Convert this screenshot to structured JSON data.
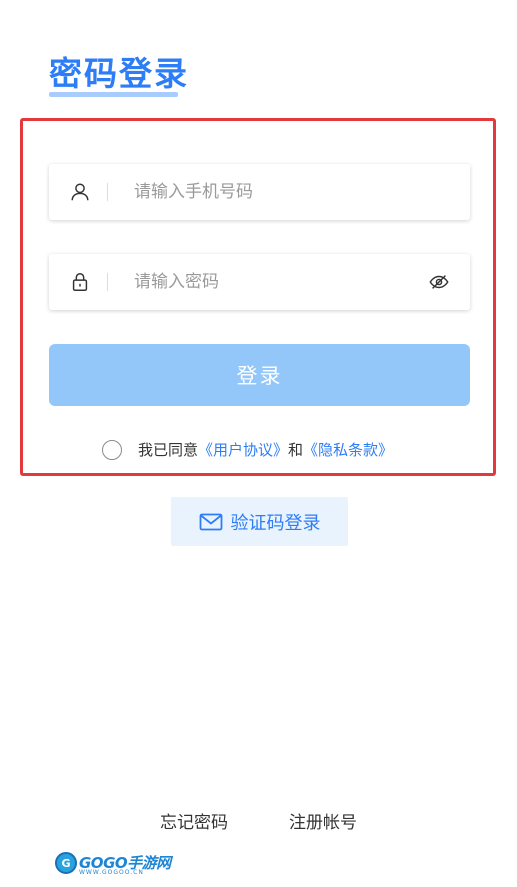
{
  "header": {
    "title": "密码登录"
  },
  "form": {
    "phone_placeholder": "请输入手机号码",
    "password_placeholder": "请输入密码",
    "login_label": "登录"
  },
  "agreement": {
    "prefix": "我已同意",
    "user_agreement": "《用户协议》",
    "and": "和",
    "privacy_policy": "《隐私条款》"
  },
  "alt_login": {
    "sms_label": "验证码登录"
  },
  "footer": {
    "forgot_label": "忘记密码",
    "register_label": "注册帐号"
  },
  "logo": {
    "mark": "G",
    "text": "GOGO手游网",
    "subtext": "WWW.GOGOO.CN"
  },
  "colors": {
    "accent": "#2d7df6",
    "button_disabled": "#93c7fa",
    "highlight_border": "#e4393c"
  },
  "icons": {
    "phone_field": "user-icon",
    "password_field": "lock-icon",
    "password_toggle": "eye-off-icon",
    "sms": "mail-icon"
  }
}
